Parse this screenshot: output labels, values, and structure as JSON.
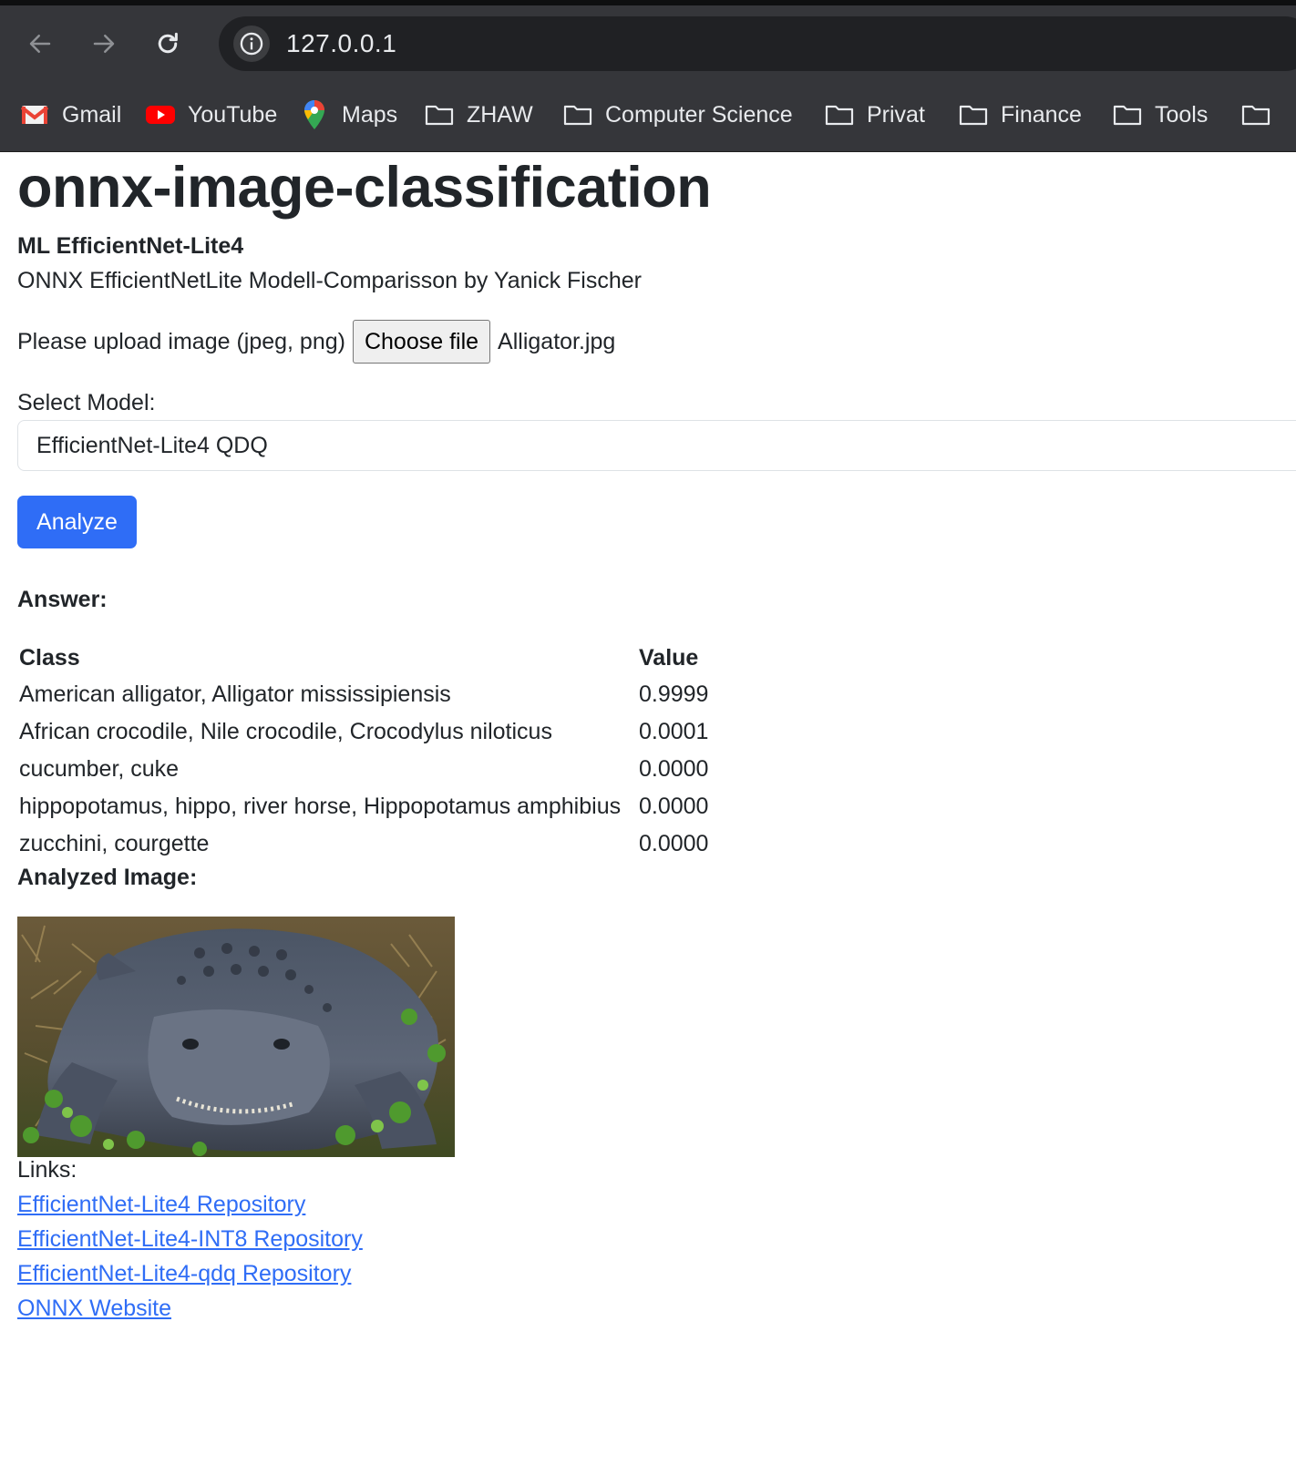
{
  "browser": {
    "url": "127.0.0.1",
    "bookmarks": [
      {
        "label": "Gmail",
        "icon": "gmail-icon"
      },
      {
        "label": "YouTube",
        "icon": "youtube-icon"
      },
      {
        "label": "Maps",
        "icon": "maps-icon"
      },
      {
        "label": "ZHAW",
        "icon": "folder-icon"
      },
      {
        "label": "Computer Science",
        "icon": "folder-icon"
      },
      {
        "label": "Privat",
        "icon": "folder-icon"
      },
      {
        "label": "Finance",
        "icon": "folder-icon"
      },
      {
        "label": "Tools",
        "icon": "folder-icon"
      }
    ]
  },
  "page": {
    "title": "onnx-image-classification",
    "subtitle_strong": "ML EfficientNet-Lite4",
    "subtitle": "ONNX EfficientNetLite Modell-Comparisson by Yanick Fischer",
    "upload_label": "Please upload image (jpeg, png)",
    "choose_file_label": "Choose file",
    "chosen_file": "Alligator.jpg",
    "select_label": "Select Model:",
    "selected_model": "EfficientNet-Lite4 QDQ",
    "analyze_label": "Analyze",
    "answer_label": "Answer:",
    "table": {
      "headers": [
        "Class",
        "Value"
      ],
      "rows": [
        [
          "American alligator, Alligator mississipiensis",
          "0.9999"
        ],
        [
          "African crocodile, Nile crocodile, Crocodylus niloticus",
          "0.0001"
        ],
        [
          "cucumber, cuke",
          "0.0000"
        ],
        [
          "hippopotamus, hippo, river horse, Hippopotamus amphibius",
          "0.0000"
        ],
        [
          "zucchini, courgette",
          "0.0000"
        ]
      ]
    },
    "analyzed_label": "Analyzed Image:",
    "links_label": "Links:",
    "links": [
      "EfficientNet-Lite4 Repository",
      "EfficientNet-Lite4-INT8 Repository",
      "EfficientNet-Lite4-qdq Repository",
      "ONNX Website"
    ],
    "colors": {
      "primary": "#2f6df6",
      "text": "#212529",
      "chrome": "#35363a"
    }
  }
}
